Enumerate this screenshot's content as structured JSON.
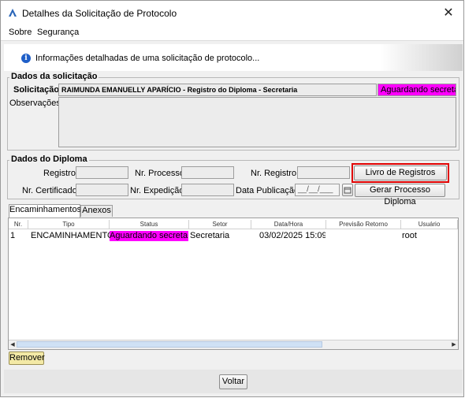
{
  "window": {
    "title": "Detalhes da Solicitação de Protocolo",
    "app_icon": "app-logo-icon",
    "close_glyph": "✕"
  },
  "menu": {
    "items": [
      "Sobre",
      "Segurança"
    ]
  },
  "info": {
    "icon": "info-icon",
    "icon_glyph": "i",
    "text": "Informações detalhadas de uma solicitação de protocolo..."
  },
  "solicitacao": {
    "group_title": "Dados da solicitação",
    "label": "Solicitação:",
    "value": "RAIMUNDA EMANUELLY APARÍCIO - Registro do Diploma - Secretaria",
    "status": "Aguardando secretaria",
    "status_color": "#ff00ff",
    "obs_label": "Observações:",
    "obs_value": ""
  },
  "diploma": {
    "group_title": "Dados do Diploma",
    "registro_label": "Registro:",
    "nr_processo_label": "Nr. Processo:",
    "nr_registro_label": "Nr. Registro:",
    "nr_certificado_label": "Nr. Certificado:",
    "nr_expedicao_label": "Nr. Expedição:",
    "data_publicacao_label": "Data Publicação:",
    "data_publicacao_value": "__/__/___",
    "livro_button": "Livro de Registros",
    "gerar_button": "Gerar Processo Diploma",
    "calendar_icon": "calendar-icon"
  },
  "tabs": [
    {
      "label": "Encaminhamentos",
      "active": true
    },
    {
      "label": "Anexos",
      "active": false
    }
  ],
  "table": {
    "headers": [
      "Nr.",
      "Tipo",
      "Status",
      "Setor",
      "Data/Hora",
      "Previsão Retorno",
      "Usuário"
    ],
    "rows": [
      {
        "nr": "1",
        "tipo": "ENCAMINHAMENTO",
        "status": "Aguardando secreta...",
        "setor": "Secretaria",
        "data_hora": "03/02/2025 15:09",
        "previsao": "",
        "usuario": "root"
      }
    ]
  },
  "buttons": {
    "remover": "Remover",
    "voltar": "Voltar"
  },
  "colors": {
    "highlight_border": "#e00000",
    "remover_bg": "#f3e9a6"
  }
}
